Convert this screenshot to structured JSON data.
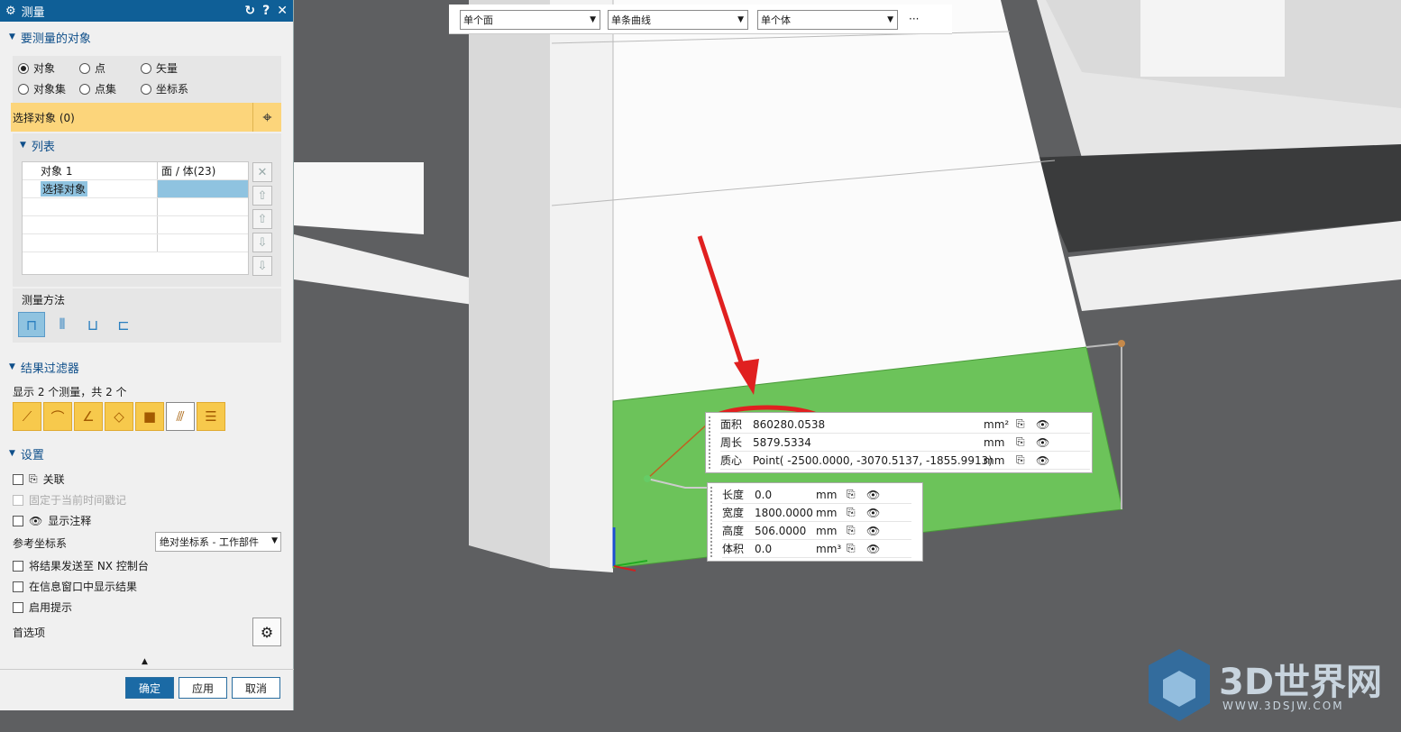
{
  "dialog": {
    "title": "测量",
    "title_controls": [
      "↻",
      "?",
      "✕"
    ],
    "section_objects": "要测量的对象",
    "radios": [
      {
        "label": "对象",
        "checked": true
      },
      {
        "label": "点",
        "checked": false
      },
      {
        "label": "矢量",
        "checked": false
      },
      {
        "label": "对象集",
        "checked": false
      },
      {
        "label": "点集",
        "checked": false
      },
      {
        "label": "坐标系",
        "checked": false
      }
    ],
    "select_label": "选择对象 (0)",
    "list_header": "列表",
    "list_rows": [
      {
        "c1": "对象 1",
        "c2": "面 / 体(23)"
      },
      {
        "c1": "选择对象",
        "c2": ""
      }
    ],
    "method_label": "测量方法",
    "section_filter": "结果过滤器",
    "filter_count": "显示 2 个测量，共 2 个",
    "section_settings": "设置",
    "settings": {
      "assoc": "关联",
      "fix_time": "固定于当前时间戳记",
      "show_note": "显示注释",
      "ref_cs_label": "参考坐标系",
      "ref_cs_value": "绝对坐标系 - 工作部件",
      "send_nx": "将结果发送至 NX 控制台",
      "show_info": "在信息窗口中显示结果",
      "enable_tip": "启用提示",
      "prefs": "首选项"
    },
    "buttons": {
      "ok": "确定",
      "apply": "应用",
      "cancel": "取消"
    }
  },
  "toolbar": {
    "sel1": "单个面",
    "sel2": "单条曲线",
    "sel3": "单个体",
    "more": "···"
  },
  "panel1": [
    {
      "label": "面积",
      "value": "860280.0538",
      "unit": "mm²"
    },
    {
      "label": "周长",
      "value": "5879.5334",
      "unit": "mm"
    },
    {
      "label": "质心",
      "value": "Point( -2500.0000, -3070.5137, -1855.9913)",
      "unit": "mm"
    }
  ],
  "panel2": [
    {
      "label": "长度",
      "value": "0.0",
      "unit": "mm"
    },
    {
      "label": "宽度",
      "value": "1800.0000",
      "unit": "mm"
    },
    {
      "label": "高度",
      "value": "506.0000",
      "unit": "mm"
    },
    {
      "label": "体积",
      "value": "0.0",
      "unit": "mm³"
    }
  ],
  "watermark": {
    "brand": "3D世界网",
    "url": "WWW.3DSJW.COM"
  },
  "colors": {
    "title_bar": "#0f5f97",
    "highlight": "#fcd57b",
    "green_face": "#6cc35a",
    "arrow": "#e02020"
  }
}
